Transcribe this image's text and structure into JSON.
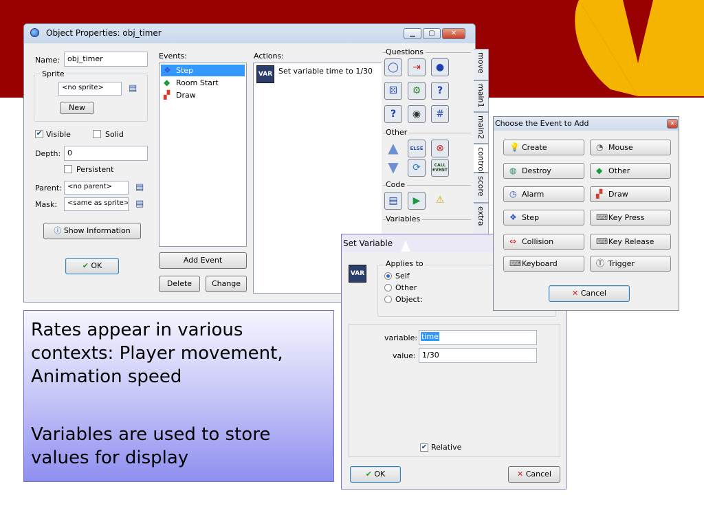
{
  "colors": {
    "banner": "#990000",
    "logo": "#f5b400",
    "selection": "#3399ff",
    "callout_top": "#f6f6ff",
    "callout_bottom": "#8f8ff0"
  },
  "object_window": {
    "title": "Object Properties: obj_timer",
    "name_label": "Name:",
    "name_value": "obj_timer",
    "sprite_group": "Sprite",
    "sprite_value": "<no sprite>",
    "new_button": "New",
    "visible_label": "Visible",
    "visible_checked": true,
    "solid_label": "Solid",
    "solid_checked": false,
    "depth_label": "Depth:",
    "depth_value": "0",
    "persistent_label": "Persistent",
    "persistent_checked": false,
    "parent_label": "Parent:",
    "parent_value": "<no parent>",
    "mask_label": "Mask:",
    "mask_value": "<same as sprite>",
    "show_info_button": "Show Information",
    "ok_button": "OK",
    "events_label": "Events:",
    "events": [
      {
        "label": "Step",
        "icon": "step-icon",
        "selected": true
      },
      {
        "label": "Room Start",
        "icon": "diamond-icon",
        "selected": false
      },
      {
        "label": "Draw",
        "icon": "draw-icon",
        "selected": false
      }
    ],
    "add_event_button": "Add Event",
    "delete_button": "Delete",
    "change_button": "Change",
    "actions_label": "Actions:",
    "actions": [
      {
        "icon_text": "VAR",
        "label": "Set variable time to 1/30"
      }
    ],
    "palette": {
      "questions_title": "Questions",
      "other_title": "Other",
      "code_title": "Code",
      "variables_title": "Variables",
      "else_text": "ELSE",
      "call_event_text": "CALL EVENT"
    },
    "tabs": [
      "move",
      "main1",
      "main2",
      "control",
      "score",
      "extra"
    ],
    "active_tab": "control"
  },
  "set_variable_window": {
    "title": "Set Variable",
    "applies_to_title": "Applies to",
    "applies_options": [
      "Self",
      "Other",
      "Object:"
    ],
    "applies_selected": "Self",
    "variable_label": "variable:",
    "variable_value": "time",
    "value_label": "value:",
    "value_value": "1/30",
    "relative_label": "Relative",
    "relative_checked": true,
    "ok_button": "OK",
    "cancel_button": "Cancel",
    "icon_text": "VAR"
  },
  "event_window": {
    "title": "Choose the Event to Add",
    "buttons": [
      {
        "label": "Create",
        "icon": "lightbulb-icon"
      },
      {
        "label": "Mouse",
        "icon": "mouse-icon"
      },
      {
        "label": "Destroy",
        "icon": "destroy-icon"
      },
      {
        "label": "Other",
        "icon": "diamond-icon"
      },
      {
        "label": "Alarm",
        "icon": "clock-icon"
      },
      {
        "label": "Draw",
        "icon": "draw-icon"
      },
      {
        "label": "Step",
        "icon": "step-icon"
      },
      {
        "label": "Key Press",
        "icon": "keyboard-icon"
      },
      {
        "label": "Collision",
        "icon": "collision-icon"
      },
      {
        "label": "Key Release",
        "icon": "keyboard-icon"
      },
      {
        "label": "Keyboard",
        "icon": "keyboard-icon"
      },
      {
        "label": "Trigger",
        "icon": "trigger-icon"
      }
    ],
    "cancel_button": "Cancel"
  },
  "callout": {
    "line1": "Rates appear in various",
    "line2": "contexts: Player movement,",
    "line3": "Animation speed",
    "line4": "Variables are used to store",
    "line5": "values for display"
  }
}
